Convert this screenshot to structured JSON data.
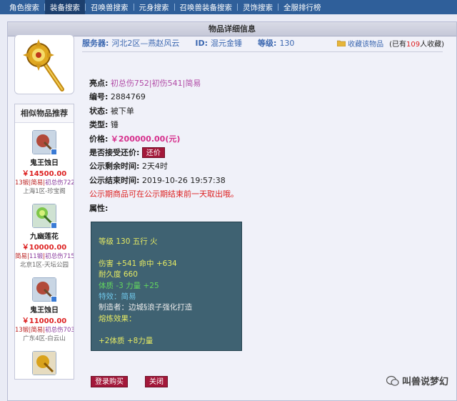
{
  "nav": {
    "tabs": [
      {
        "label": "角色搜索"
      },
      {
        "label": "装备搜索"
      },
      {
        "label": "召唤兽搜索"
      },
      {
        "label": "元身搜索"
      },
      {
        "label": "召唤兽装备搜索"
      },
      {
        "label": "灵饰搜索"
      },
      {
        "label": "全服排行榜"
      }
    ],
    "active_index": 1
  },
  "panel": {
    "title": "物品详细信息"
  },
  "meta": {
    "server_label": "服务器:",
    "server_value": "河北2区—燕赵风云",
    "id_label": "ID:",
    "id_value": "混元金锤",
    "level_label": "等级:",
    "level_value": "130",
    "fav_link": "收藏该物品",
    "fav_prefix": "(已有",
    "fav_count": "109",
    "fav_suffix": "人收藏)"
  },
  "details": {
    "highlights_label": "亮点:",
    "highlights": [
      "初总伤752",
      "初伤541",
      "简易"
    ],
    "sep": "|",
    "code_label": "编号:",
    "code_value": "2884769",
    "status_label": "状态:",
    "status_value": "被下单",
    "type_label": "类型:",
    "type_value": "锤",
    "price_label": "价格:",
    "price_value": "￥200000.00(元)",
    "bargain_label": "是否接受还价:",
    "bargain_button": "还价",
    "remain_label": "公示剩余时间:",
    "remain_value": "2天4时",
    "end_label": "公示结束时间:",
    "end_value": "2019-10-26 19:57:38",
    "notice": "公示期商品可在公示期结束前一天取出哦。",
    "attr_label": "属性:"
  },
  "attrs": {
    "line1": "等级 130  五行 火",
    "line2": "伤害 +541  命中 +634",
    "line3": "耐久度 660",
    "line4": "体质 -3  力量 +25",
    "line5": "特效：简易",
    "line6": "制造者：边城§浪子强化打造",
    "line7": "熔炼效果：",
    "line8": "+2体质 +8力量"
  },
  "similar": {
    "title": "相似物品推荐",
    "items": [
      {
        "name": "鬼王蚀日",
        "price": "￥14500.00",
        "tag1": "13锻",
        "tag2": "简易",
        "tag3": "初总伤722",
        "location": "上海1区-珍宝阁"
      },
      {
        "name": "九幽莲花",
        "price": "￥10000.00",
        "tag1": "简易",
        "tag2": "11锻",
        "tag3": "初总伤715",
        "location": "北京1区-天坛公园"
      },
      {
        "name": "鬼王蚀日",
        "price": "￥11000.00",
        "tag1": "13锻",
        "tag2": "简易",
        "tag3": "初总伤703",
        "location": "广东4区-白云山"
      }
    ]
  },
  "buttons": {
    "buy": "登录购买",
    "close": "关闭"
  },
  "watermark": {
    "text": "叫兽说梦幻"
  },
  "colors": {
    "nav_bg": "#2f5f9a",
    "accent_button": "#a3183a",
    "attr_box": "#3f6272"
  }
}
